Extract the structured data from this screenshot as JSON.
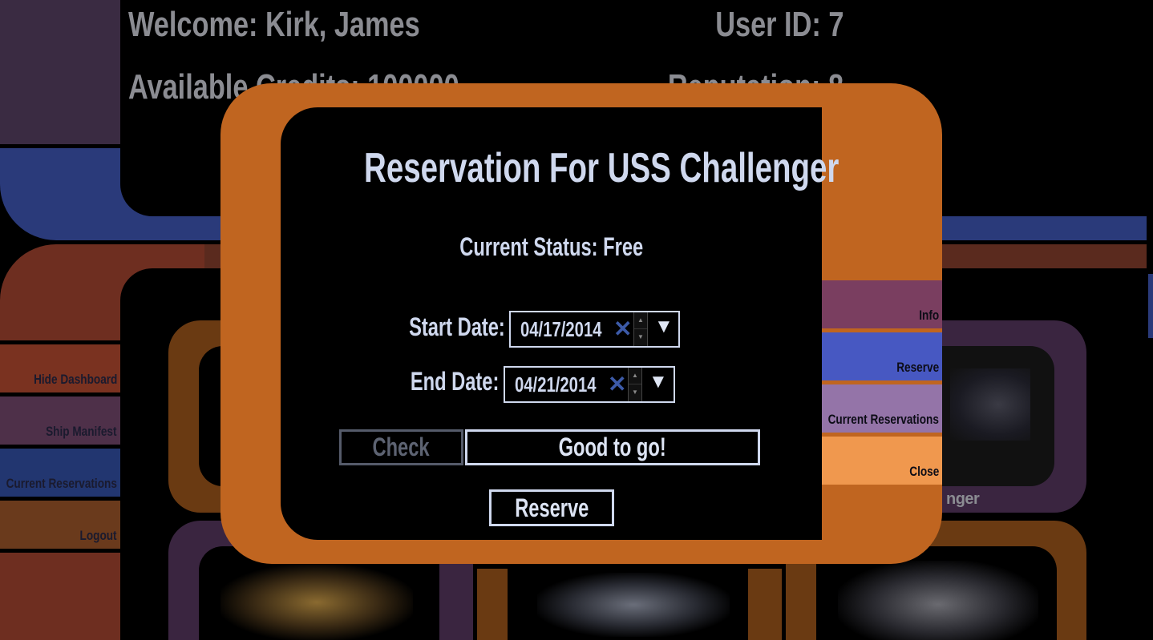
{
  "header": {
    "welcome": "Welcome: Kirk, James",
    "user_id": "User ID: 7",
    "credits": "Available Credits: 100000",
    "reputation": "Reputation: 8"
  },
  "sidebar": {
    "items": [
      {
        "label": "Hide Dashboard",
        "color": "#7a3220"
      },
      {
        "label": "Ship Manifest",
        "color": "#4e3049"
      },
      {
        "label": "Current Reservations",
        "color": "#223670"
      },
      {
        "label": "Logout",
        "color": "#6a3a1c"
      }
    ]
  },
  "panel_menu": {
    "items": [
      {
        "label": "Info",
        "color": "#7a3e60"
      },
      {
        "label": "Reserve",
        "color": "#4758c2"
      },
      {
        "label": "Current Reservations",
        "color": "#9474a8"
      },
      {
        "label": "Close",
        "color": "#f0984e"
      }
    ]
  },
  "bg_ship_label": "nger",
  "modal": {
    "title": "Reservation For USS Challenger",
    "status": "Current Status: Free",
    "start_label": "Start Date:",
    "start_value": "04/17/2014",
    "end_label": "End Date:",
    "end_value": "04/21/2014",
    "check_label": "Check",
    "result_text": "Good to go!",
    "reserve_label": "Reserve"
  },
  "colors": {
    "frame_orange": "#c06520",
    "text_light": "#cfd8ee",
    "clear_blue": "#3c5aa8"
  }
}
